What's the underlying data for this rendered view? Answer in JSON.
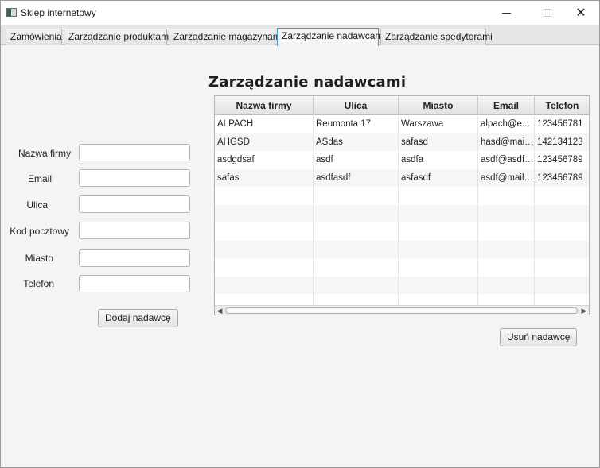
{
  "window": {
    "title": "Sklep internetowy",
    "controls": {
      "minimize": "—",
      "maximize": "□",
      "close": "✕"
    }
  },
  "tabs": [
    {
      "label": "Zamówienia"
    },
    {
      "label": "Zarządzanie produktami"
    },
    {
      "label": "Zarządzanie magazynami"
    },
    {
      "label": "Zarządzanie nadawcami",
      "active": true
    },
    {
      "label": "Zarządzanie spedytorami"
    }
  ],
  "main": {
    "title": "Zarządzanie nadawcami"
  },
  "form": {
    "fields": [
      {
        "label": "Nazwa firmy",
        "value": "",
        "placeholder": ""
      },
      {
        "label": "Email",
        "value": "",
        "placeholder": ""
      },
      {
        "label": "Ulica",
        "value": "",
        "placeholder": ""
      },
      {
        "label": "Kod pocztowy",
        "value": "",
        "placeholder": ""
      },
      {
        "label": "Miasto",
        "value": "",
        "placeholder": ""
      },
      {
        "label": "Telefon",
        "value": "",
        "placeholder": ""
      }
    ],
    "add_button": "Dodaj nadawcę"
  },
  "table": {
    "columns": [
      "Nazwa firmy",
      "Ulica",
      "Miasto",
      "Email",
      "Telefon"
    ],
    "rows": [
      [
        "ALPACH",
        "Reumonta 17",
        "Warszawa",
        "alpach@e...",
        "123456781"
      ],
      [
        "AHGSD",
        "ASdas",
        "safasd",
        "hasd@mail...",
        "142134123"
      ],
      [
        "asdgdsaf",
        "asdf",
        "asdfa",
        "asdf@asdf....",
        "123456789"
      ],
      [
        "safas",
        "asdfasdf",
        "asfasdf",
        "asdf@mail....",
        "123456789"
      ],
      [
        "",
        "",
        "",
        "",
        ""
      ],
      [
        "",
        "",
        "",
        "",
        ""
      ],
      [
        "",
        "",
        "",
        "",
        ""
      ],
      [
        "",
        "",
        "",
        "",
        ""
      ],
      [
        "",
        "",
        "",
        "",
        ""
      ],
      [
        "",
        "",
        "",
        "",
        ""
      ],
      [
        "",
        "",
        "",
        "",
        ""
      ]
    ]
  },
  "delete_button": "Usuń nadawcę",
  "colors": {
    "active_tab_border": "#3fa0d8",
    "window_background": "#f4f4f4"
  }
}
